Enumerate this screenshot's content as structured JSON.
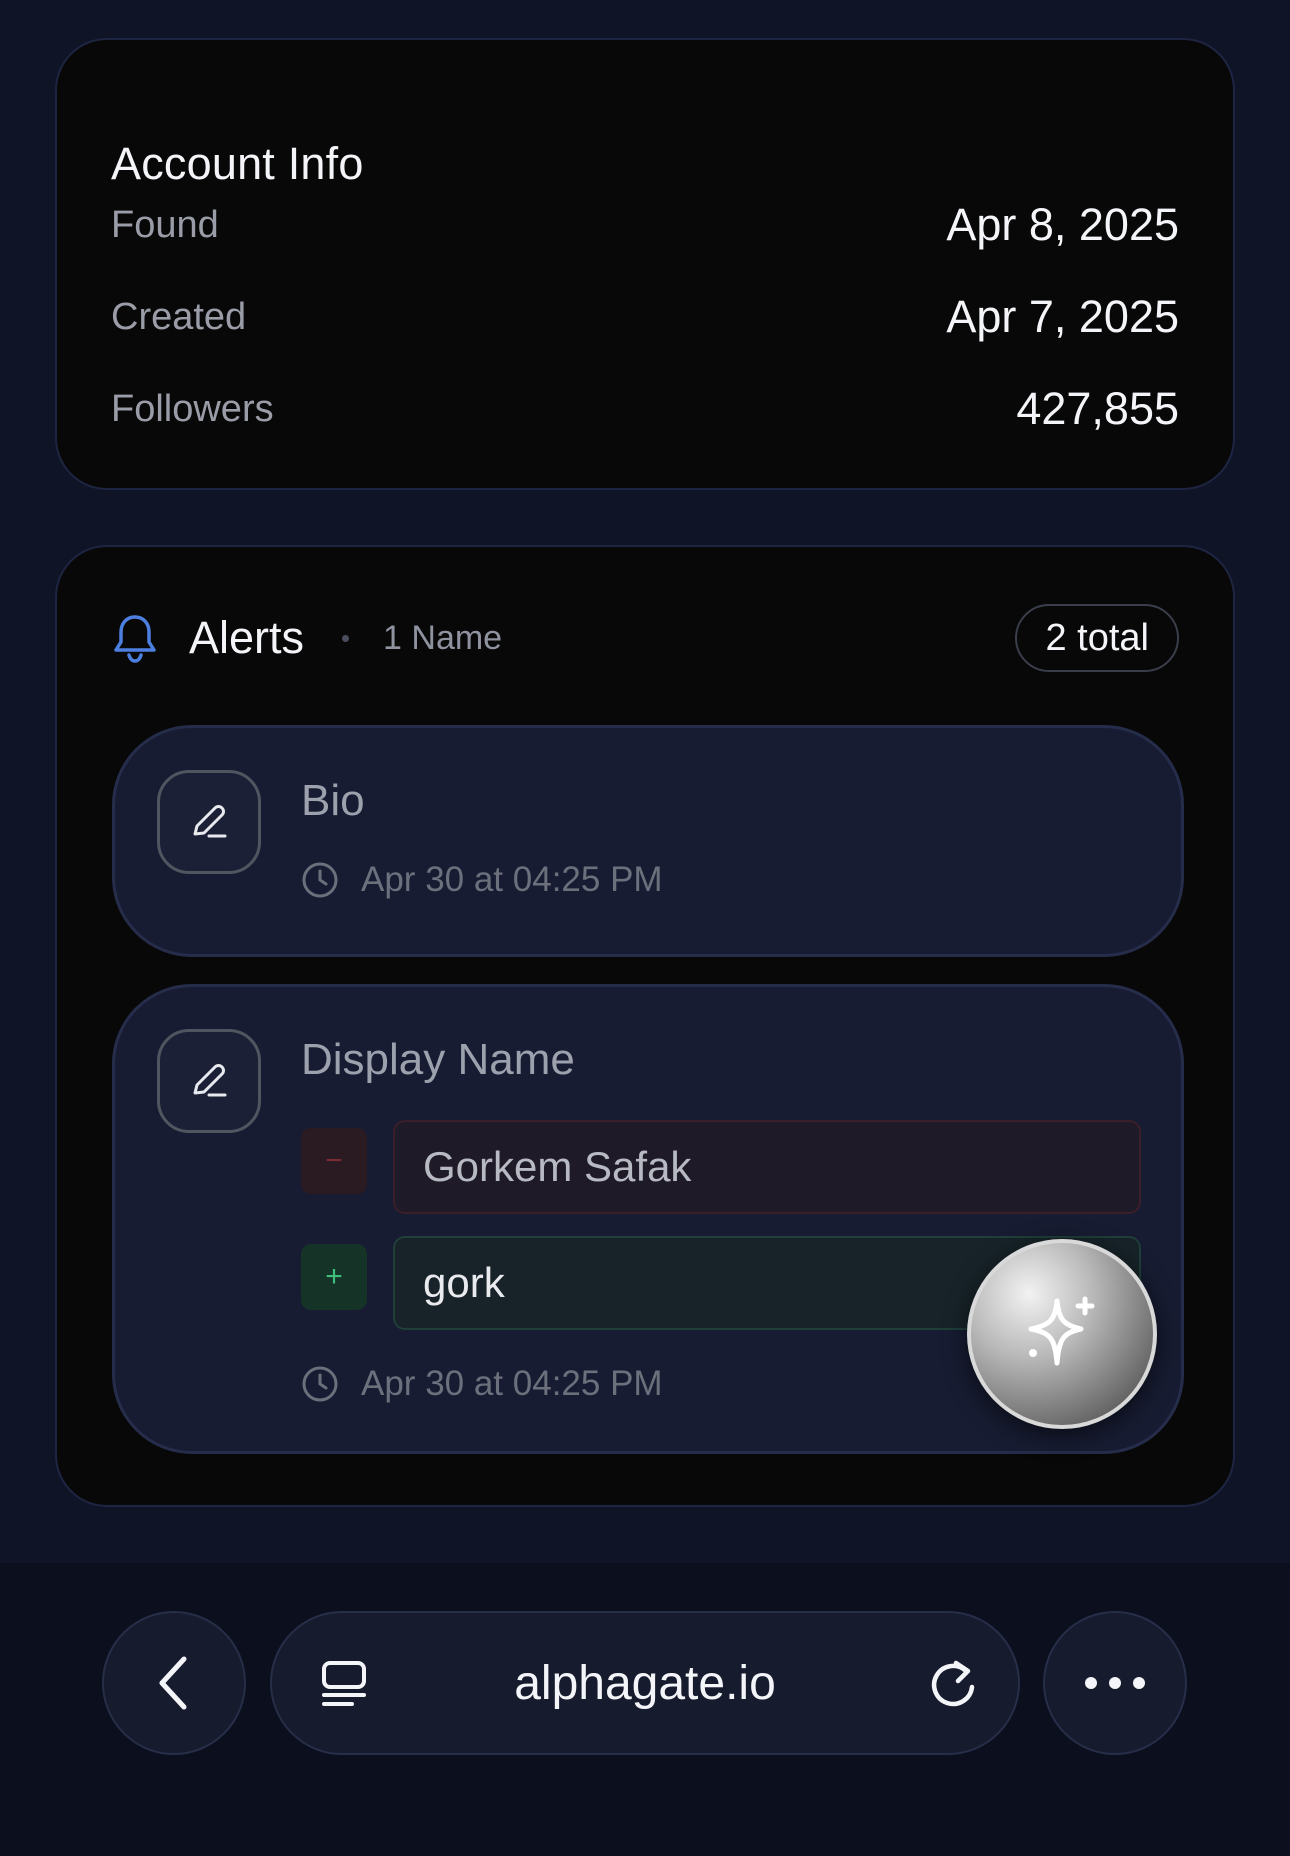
{
  "account_info": {
    "title": "Account Info",
    "rows": [
      {
        "label": "Found",
        "value": "Apr 8, 2025"
      },
      {
        "label": "Created",
        "value": "Apr 7, 2025"
      },
      {
        "label": "Followers",
        "value": "427,855"
      }
    ]
  },
  "alerts": {
    "title": "Alerts",
    "subtitle": "1 Name",
    "total_badge": "2 total",
    "items": [
      {
        "field": "Bio",
        "time": "Apr 30 at 04:25 PM"
      },
      {
        "field": "Display Name",
        "removed_sign": "−",
        "removed_value": "Gorkem Safak",
        "added_sign": "+",
        "added_value": "gork",
        "time": "Apr 30 at 04:25 PM"
      }
    ]
  },
  "browser": {
    "url": "alphagate.io"
  },
  "icons": {
    "bell": "bell-icon",
    "edit": "pencil-icon",
    "clock": "clock-icon",
    "sparkle": "sparkle-icon",
    "back": "chevron-left-icon",
    "tabs": "tabs-icon",
    "reload": "reload-icon",
    "more": "more-icon"
  },
  "colors": {
    "background": "#0f1426",
    "card": "#080808",
    "alert_item": "#171c32",
    "accent_blue": "#4d7fe0",
    "added_green": "#3ec07d",
    "removed_red": "#7a2b34"
  }
}
